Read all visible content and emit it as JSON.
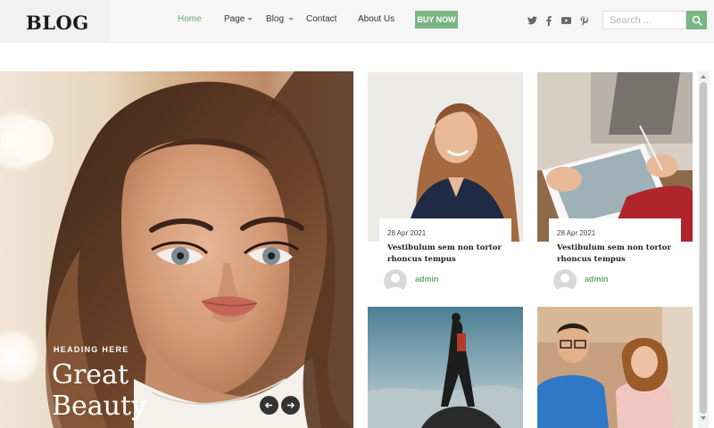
{
  "header": {
    "logo": "BLOG",
    "nav": [
      {
        "label": "Home",
        "active": true
      },
      {
        "label": "Page",
        "dropdown": true
      },
      {
        "label": "Blog",
        "dropdown": true
      },
      {
        "label": "Contact"
      },
      {
        "label": "About Us"
      }
    ],
    "buy_now": "BUY NOW",
    "social_icons": [
      "twitter-icon",
      "facebook-icon",
      "youtube-icon",
      "pinterest-icon"
    ],
    "search": {
      "placeholder": "Search ...",
      "value": ""
    }
  },
  "hero": {
    "heading": "HEADING HERE",
    "title": "Great Beauty"
  },
  "cards": [
    {
      "date": "28 Apr 2021",
      "title": "Vestibulum sem non tortor rhoncus tempus",
      "author": "admin"
    },
    {
      "date": "28 Apr 2021",
      "title": "Vestibulum sem non tortor rhoncus tempus",
      "author": "admin"
    },
    {
      "date": "",
      "title": "",
      "author": ""
    },
    {
      "date": "",
      "title": "",
      "author": ""
    }
  ],
  "colors": {
    "accent": "#7ab584",
    "accent_text": "#6aa96f",
    "header_bg": "#f6f6f6",
    "title_text": "#222222"
  }
}
